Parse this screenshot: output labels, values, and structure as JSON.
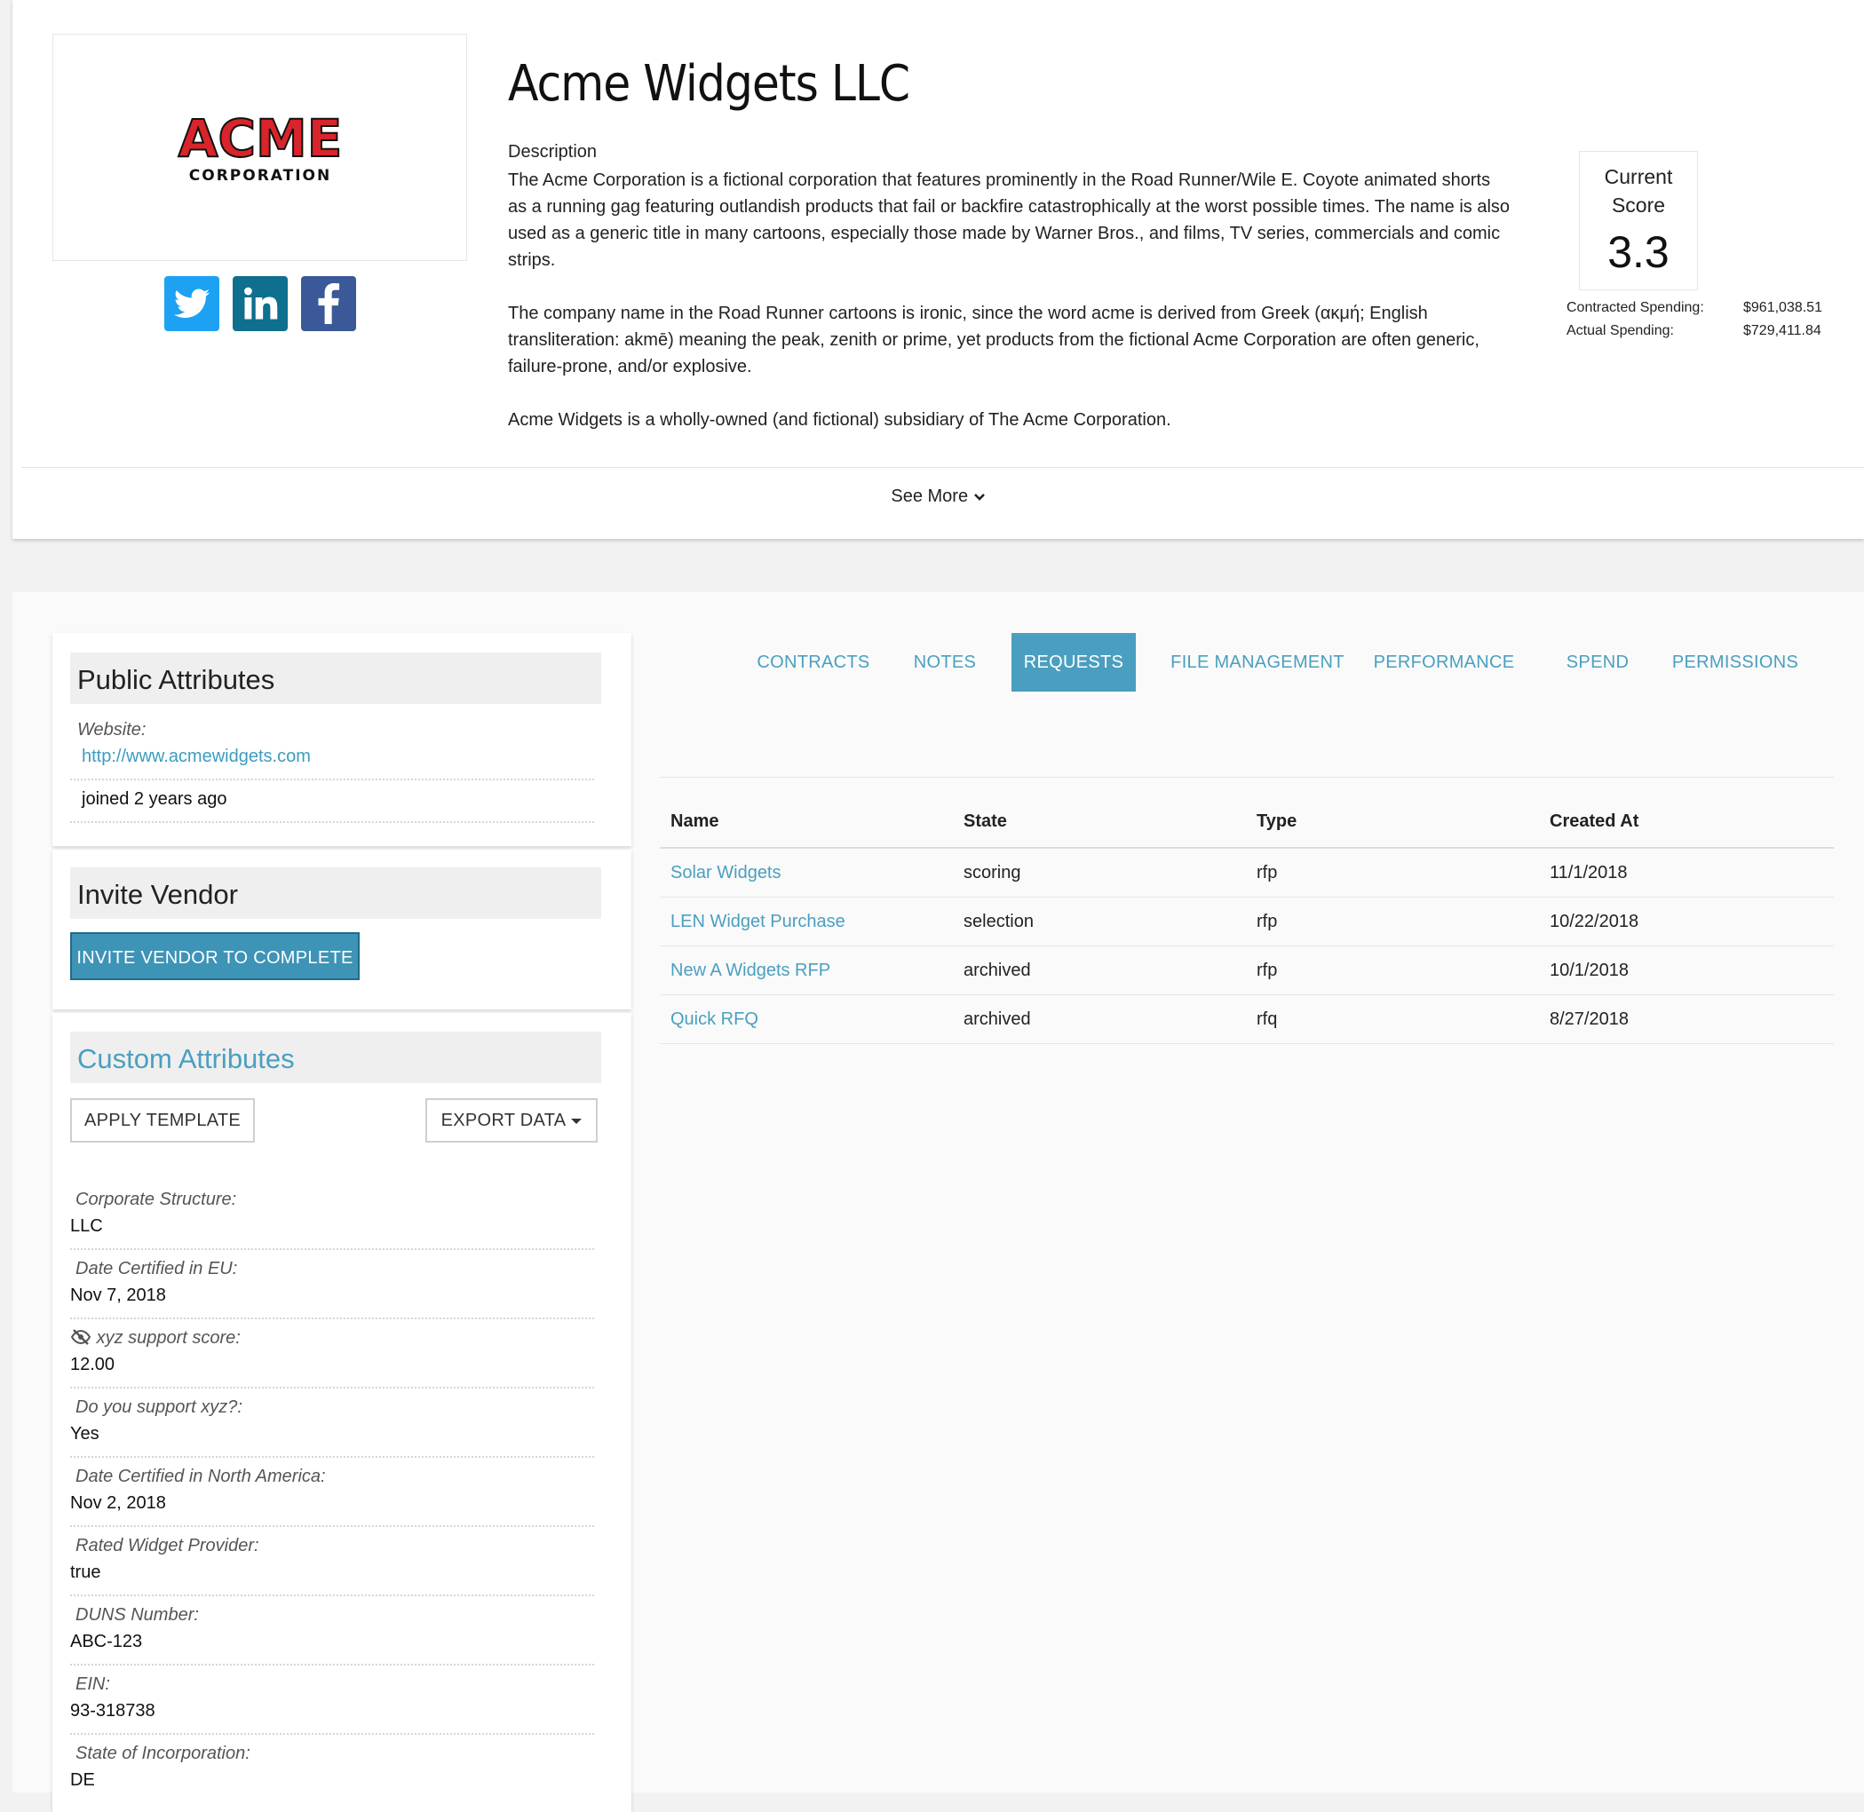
{
  "vendor": {
    "name": "Acme Widgets LLC",
    "logo": {
      "top_text": "ACME",
      "bottom_text": "CORPORATION"
    },
    "description_label": "Description",
    "description_paragraphs": [
      "The Acme Corporation is a fictional corporation that features prominently in the Road Runner/Wile E. Coyote animated shorts as a running gag featuring outlandish products that fail or backfire catastrophically at the worst possible times. The name is also used as a generic title in many cartoons, especially those made by Warner Bros., and films, TV series, commercials and comic strips.",
      "The company name in the Road Runner cartoons is ironic, since the word acme is derived from Greek (ακμή; English transliteration: akmē) meaning the peak, zenith or prime, yet products from the fictional Acme Corporation are often generic, failure-prone, and/or explosive.",
      "Acme Widgets is a wholly-owned (and fictional) subsidiary of The Acme Corporation."
    ],
    "see_more": "See More",
    "socials": [
      "twitter-icon",
      "linkedin-icon",
      "facebook-icon"
    ]
  },
  "score": {
    "label": "Current Score",
    "value": "3.3",
    "contracted_label": "Contracted Spending:",
    "contracted_value": "$961,038.51",
    "actual_label": "Actual Spending:",
    "actual_value": "$729,411.84"
  },
  "public_attributes": {
    "title": "Public Attributes",
    "website_label": "Website:",
    "website_url": "http://www.acmewidgets.com",
    "joined": "joined 2 years ago"
  },
  "invite_vendor": {
    "title": "Invite Vendor",
    "button": "INVITE VENDOR TO COMPLETE"
  },
  "custom_attributes": {
    "title": "Custom Attributes",
    "apply_template": "APPLY TEMPLATE",
    "export_data": "EXPORT DATA",
    "items": [
      {
        "label": "Corporate Structure:",
        "value": "LLC"
      },
      {
        "label": "Date Certified in EU:",
        "value": "Nov 7, 2018"
      },
      {
        "label": "xyz support score:",
        "value": "12.00",
        "icon": "eye-slash-icon"
      },
      {
        "label": "Do you support xyz?:",
        "value": "Yes"
      },
      {
        "label": "Date Certified in North America:",
        "value": "Nov 2, 2018"
      },
      {
        "label": "Rated Widget Provider:",
        "value": "true"
      },
      {
        "label": "DUNS Number:",
        "value": "ABC-123"
      },
      {
        "label": "EIN:",
        "value": "93-318738"
      },
      {
        "label": "State of Incorporation:",
        "value": "DE"
      }
    ]
  },
  "tabs": [
    {
      "label": "CONTRACTS",
      "active": false
    },
    {
      "label": "NOTES",
      "active": false
    },
    {
      "label": "REQUESTS",
      "active": true
    },
    {
      "label": "FILE MANAGEMENT",
      "active": false
    },
    {
      "label": "PERFORMANCE",
      "active": false
    },
    {
      "label": "SPEND",
      "active": false
    },
    {
      "label": "PERMISSIONS",
      "active": false
    }
  ],
  "requests_table": {
    "columns": [
      "Name",
      "State",
      "Type",
      "Created At"
    ],
    "rows": [
      [
        "Solar Widgets",
        "scoring",
        "rfp",
        "11/1/2018"
      ],
      [
        "LEN Widget Purchase",
        "selection",
        "rfp",
        "10/22/2018"
      ],
      [
        "New A Widgets RFP",
        "archived",
        "rfp",
        "10/1/2018"
      ],
      [
        "Quick RFQ",
        "archived",
        "rfq",
        "8/27/2018"
      ]
    ]
  },
  "colors": {
    "accent": "#4a9fc0",
    "button": "#3d94b7",
    "twitter": "#1da1f2",
    "linkedin": "#0e6f8f",
    "facebook": "#3b5998",
    "acme_red": "#d8242a"
  }
}
